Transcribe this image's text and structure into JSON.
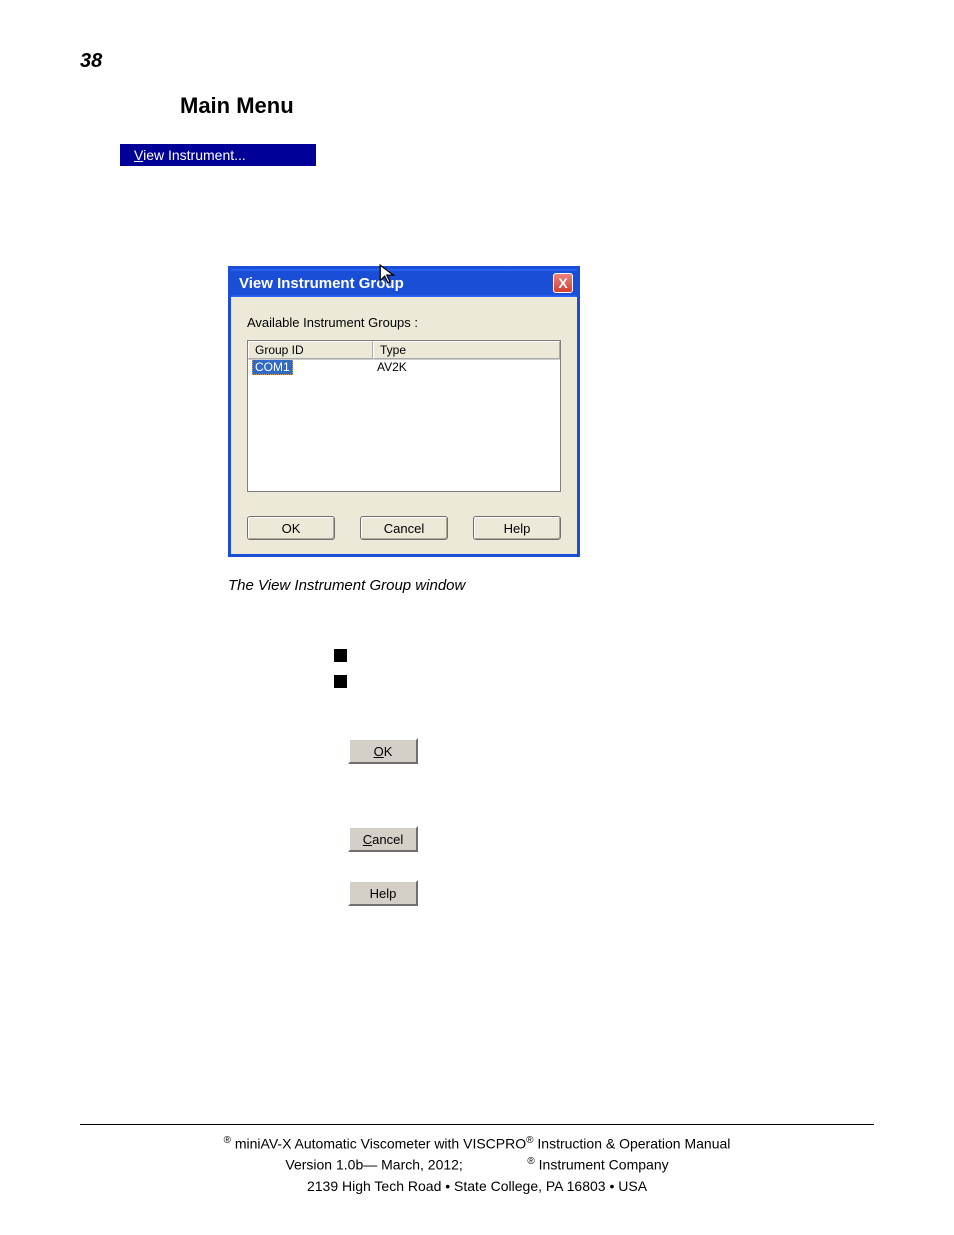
{
  "page": {
    "number": "38",
    "section_title": "Main Menu"
  },
  "menu_item": {
    "prefix": "V",
    "rest": "iew Instrument..."
  },
  "dialog": {
    "title": "View Instrument Group",
    "close_glyph": "X",
    "available_label": "Available Instrument Groups :",
    "columns": {
      "group_id": "Group ID",
      "type": "Type"
    },
    "rows": [
      {
        "group_id": "COM1",
        "type": "AV2K",
        "selected": true
      }
    ],
    "buttons": {
      "ok": "OK",
      "cancel": "Cancel",
      "help": "Help"
    }
  },
  "caption": "The View Instrument Group window",
  "inline_buttons": {
    "ok_prefix": "O",
    "ok_rest": "K",
    "cancel_prefix": "C",
    "cancel_rest": "ancel",
    "help": "Help"
  },
  "footer": {
    "line1_a": " miniAV-X Automatic Viscometer with VISCPRO",
    "line1_b": " Instruction & Operation Manual",
    "line2_a": "Version 1.0b— March, 2012;",
    "line2_b": " Instrument Company",
    "line3": "2139 High Tech Road • State College, PA  16803 • USA",
    "reg": "®"
  }
}
